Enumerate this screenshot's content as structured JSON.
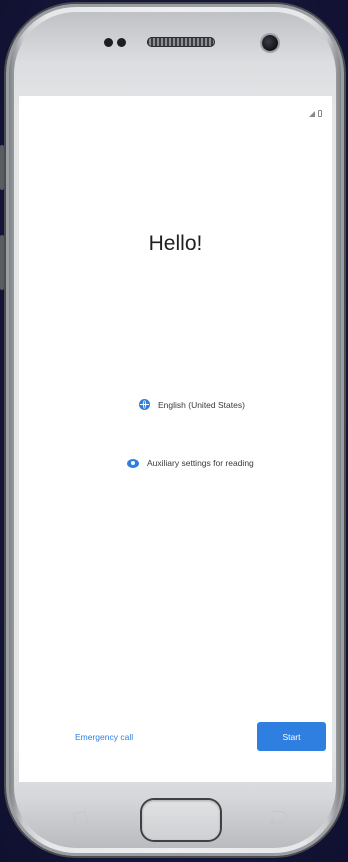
{
  "screen": {
    "title": "Hello!",
    "language_option": "English (United States)",
    "reading_option": "Auxiliary settings for reading",
    "emergency_call": "Emergency call",
    "start_button": "Start"
  },
  "status_bar": {
    "icons": [
      "signal-icon",
      "battery-icon"
    ]
  },
  "icons": {
    "language": "globe-icon",
    "reading": "eye-icon"
  },
  "colors": {
    "accent": "#2f7fe0",
    "background": "#15163a",
    "screen": "#ffffff"
  }
}
